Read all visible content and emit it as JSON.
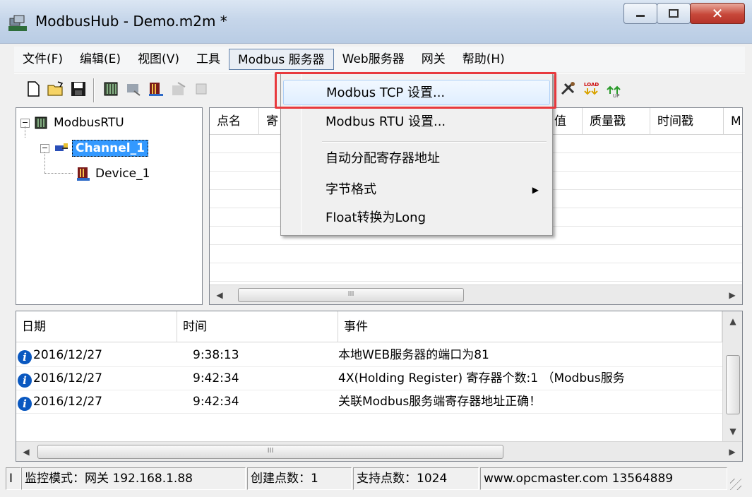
{
  "window": {
    "title": "ModbusHub - Demo.m2m *"
  },
  "menubar": [
    "文件(F)",
    "编辑(E)",
    "视图(V)",
    "工具",
    "Modbus 服务器",
    "Web服务器",
    "网关",
    "帮助(H)"
  ],
  "tree": {
    "root": "ModbusRTU",
    "channel": "Channel_1",
    "device": "Device_1"
  },
  "grid": {
    "columns": [
      "点名",
      "寄",
      "值",
      "质量戳",
      "时间戳",
      "M"
    ],
    "scroll_grip": "III"
  },
  "dropdown": {
    "items": [
      "Modbus TCP 设置...",
      "Modbus RTU 设置...",
      "自动分配寄存器地址",
      "字节格式",
      "Float转换为Long"
    ],
    "highlighted_index": 0
  },
  "log": {
    "columns": [
      "日期",
      "时间",
      "事件"
    ],
    "rows": [
      {
        "date": "2016/12/27",
        "time": "9:38:13",
        "event": "本地WEB服务器的端口为81"
      },
      {
        "date": "2016/12/27",
        "time": "9:42:34",
        "event": "4X(Holding Register) 寄存器个数:1 （Modbus服务"
      },
      {
        "date": "2016/12/27",
        "time": "9:42:34",
        "event": "关联Modbus服务端寄存器地址正确！"
      }
    ],
    "scroll_grip": "III"
  },
  "statusbar": {
    "first": "I",
    "mode": "监控模式：网关 192.168.1.88",
    "created": "创建点数：1",
    "supported": "支持点数：1024",
    "site": "www.opcmaster.com 13564889"
  },
  "colors": {
    "highlight_box": "#e8393d",
    "selection": "#3399ff",
    "info_icon": "#0a58c0"
  }
}
